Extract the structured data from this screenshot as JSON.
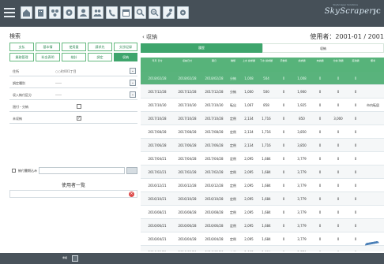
{
  "toolbar": {
    "brand": "SkyScraper",
    "brand_suffix": "JC",
    "brand_sub": "SkyScraper Solutions"
  },
  "left": {
    "title": "検索",
    "tabs": [
      "支払",
      "基本情",
      "使用量",
      "請求先",
      "交渉記録",
      "業務管理",
      "料金表明",
      "検針",
      "調定",
      "収納"
    ],
    "rows": [
      {
        "label": "住所",
        "value": "○○町001丁目"
      },
      {
        "label": "調定種別",
        "value": "――"
      },
      {
        "label": "収入納付区分",
        "value": "――"
      },
      {
        "label": "過付・分納",
        "value": ""
      },
      {
        "label": "未収納",
        "value": "✓"
      }
    ],
    "filter_label": "納付書期込み",
    "user_list_title": "使用者一覧"
  },
  "right": {
    "breadcrumb": "収納",
    "user_no": "使用者：2001-01 / 2001",
    "segment": [
      "履歴",
      "収納"
    ],
    "columns": [
      "年月\n日付",
      "収納日付",
      "期日",
      "種類",
      "上水\n請求額",
      "下水\n請求額",
      "手数料",
      "請求額",
      "未納額",
      "分納\n残額",
      "延滞額",
      "備考"
    ],
    "rows": [
      [
        "2018/02/28",
        "2018/02/28",
        "2018/02/28",
        "分納",
        "1,008",
        "504",
        "0",
        "1,008",
        "0",
        "0",
        "0",
        ""
      ],
      [
        "2017/12/28",
        "2017/12/28",
        "2017/12/28",
        "分納",
        "1,000",
        "500",
        "0",
        "1,900",
        "0",
        "0",
        "0",
        ""
      ],
      [
        "2017/10/30",
        "2017/10/30",
        "2017/10/30",
        "転出",
        "1,067",
        "858",
        "0",
        "1,925",
        "0",
        "0",
        "0",
        "市内転居"
      ],
      [
        "2017/10/28",
        "2017/10/28",
        "2017/10/28",
        "定例",
        "2,134",
        "1,716",
        "0",
        "850",
        "0",
        "3,000",
        "0",
        ""
      ],
      [
        "2017/08/28",
        "2017/08/28",
        "2017/08/28",
        "定例",
        "2,134",
        "1,716",
        "0",
        "3,850",
        "0",
        "0",
        "0",
        ""
      ],
      [
        "2017/06/28",
        "2017/06/28",
        "2017/06/28",
        "定例",
        "2,134",
        "1,716",
        "0",
        "3,850",
        "0",
        "0",
        "0",
        ""
      ],
      [
        "2017/04/21",
        "2017/04/28",
        "2017/04/28",
        "定例",
        "2,095",
        "1,684",
        "0",
        "3,779",
        "0",
        "0",
        "0",
        ""
      ],
      [
        "2017/02/21",
        "2017/02/28",
        "2017/02/28",
        "定例",
        "2,095",
        "1,684",
        "0",
        "3,779",
        "0",
        "0",
        "0",
        ""
      ],
      [
        "2016/12/21",
        "2016/12/28",
        "2016/12/28",
        "定例",
        "2,095",
        "1,684",
        "0",
        "3,779",
        "0",
        "0",
        "0",
        ""
      ],
      [
        "2016/10/21",
        "2016/10/28",
        "2016/10/28",
        "定例",
        "2,095",
        "1,684",
        "0",
        "3,779",
        "0",
        "0",
        "0",
        ""
      ],
      [
        "2016/08/21",
        "2016/08/28",
        "2016/08/28",
        "定例",
        "2,095",
        "1,684",
        "0",
        "3,779",
        "0",
        "0",
        "0",
        ""
      ],
      [
        "2016/06/21",
        "2016/06/28",
        "2016/06/28",
        "定例",
        "2,095",
        "1,684",
        "0",
        "3,779",
        "0",
        "0",
        "0",
        ""
      ],
      [
        "2016/04/21",
        "2016/04/28",
        "2016/04/28",
        "定例",
        "2,095",
        "1,684",
        "0",
        "3,779",
        "0",
        "0",
        "0",
        ""
      ],
      [
        "2016/02/21",
        "2016/02/28",
        "2016/02/28",
        "定例",
        "2,095",
        "1,684",
        "0",
        "3,779",
        "0",
        "0",
        "0",
        ""
      ]
    ]
  },
  "bottom": {
    "items": [
      "重複",
      "",
      "",
      "",
      "",
      "",
      "",
      "",
      "",
      "",
      "",
      ""
    ]
  }
}
